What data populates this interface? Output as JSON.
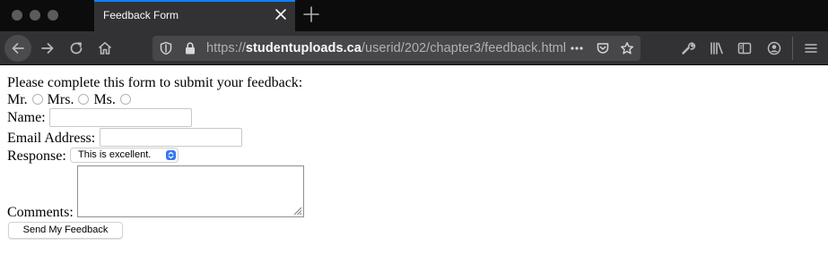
{
  "window": {
    "tab_title": "Feedback Form"
  },
  "navigation": {
    "url_prefix": "https://",
    "url_domain": "studentuploads.ca",
    "url_path": "/userid/202/chapter3/feedback.html"
  },
  "form": {
    "intro": "Please complete this form to submit your feedback:",
    "title_options": [
      "Mr.",
      "Mrs.",
      "Ms."
    ],
    "name_label": "Name:",
    "name_value": "",
    "email_label": "Email Address:",
    "email_value": "",
    "response_label": "Response:",
    "response_selected": "This is excellent.",
    "comments_label": "Comments:",
    "comments_value": "",
    "submit_label": "Send My Feedback"
  },
  "colors": {
    "tab_strip": "#0c0c0d",
    "toolbar": "#323234",
    "url_field": "#474749",
    "accent": "#0a84ff",
    "select_arrow": "#3478f6"
  },
  "icons": {
    "tab": [
      "close-icon",
      "new-tab-icon"
    ],
    "toolbar": [
      "back-arrow-icon",
      "forward-arrow-icon",
      "reload-icon",
      "home-icon",
      "tracking-shield-icon",
      "lock-icon",
      "page-actions-icon",
      "pocket-icon",
      "bookmark-star-icon",
      "wrench-icon",
      "library-icon",
      "sidebar-icon",
      "account-icon",
      "menu-icon"
    ]
  }
}
